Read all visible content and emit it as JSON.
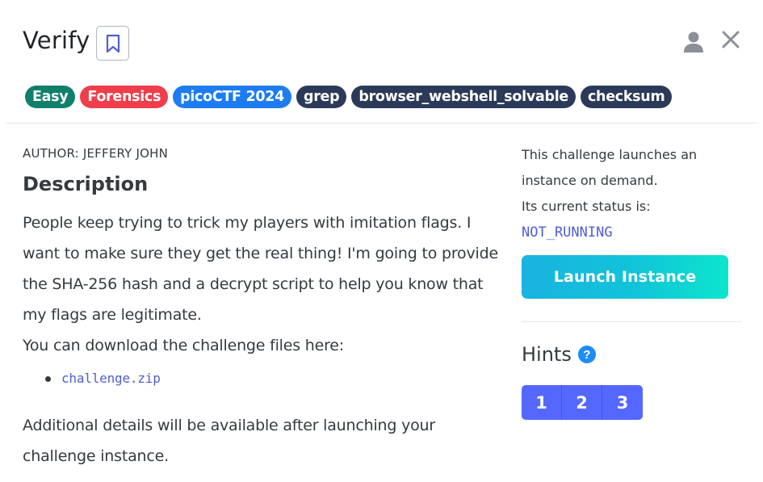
{
  "header": {
    "title": "Verify",
    "tags": [
      {
        "label": "Easy",
        "color": "#10806c"
      },
      {
        "label": "Forensics",
        "color": "#ef3d4a"
      },
      {
        "label": "picoCTF 2024",
        "color": "#1d7cf2"
      },
      {
        "label": "grep",
        "color": "#2b3a59"
      },
      {
        "label": "browser_webshell_solvable",
        "color": "#2b3a59"
      },
      {
        "label": "checksum",
        "color": "#2b3a59"
      }
    ],
    "icons": {
      "bookmark": "bookmark-icon",
      "user": "user-icon",
      "close": "close-icon"
    }
  },
  "main": {
    "author": "AUTHOR: JEFFERY JOHN",
    "description_title": "Description",
    "description_lines": [
      "People keep trying to trick my players with imitation flags. I",
      "want to make sure they get the real thing! I'm going to provide",
      "the SHA-256 hash and a decrypt script to help you know that",
      "my flags are legitimate.",
      "You can download the challenge files here:"
    ],
    "files": [
      "challenge.zip"
    ],
    "additional_lines": [
      "Additional details will be available after launching your",
      "challenge instance."
    ]
  },
  "sidebar": {
    "instance_lines": [
      "This challenge launches an",
      "instance on demand.",
      "Its current status is:"
    ],
    "status": "NOT_RUNNING",
    "launch_label": "Launch Instance",
    "hints_title": "Hints",
    "help_icon_label": "?",
    "hints": [
      "1",
      "2",
      "3"
    ]
  },
  "colors": {
    "accent": "#5468ff",
    "link": "#4e5fd6",
    "launch_gradient_start": "#1ab3e0",
    "launch_gradient_end": "#0de5cc"
  }
}
